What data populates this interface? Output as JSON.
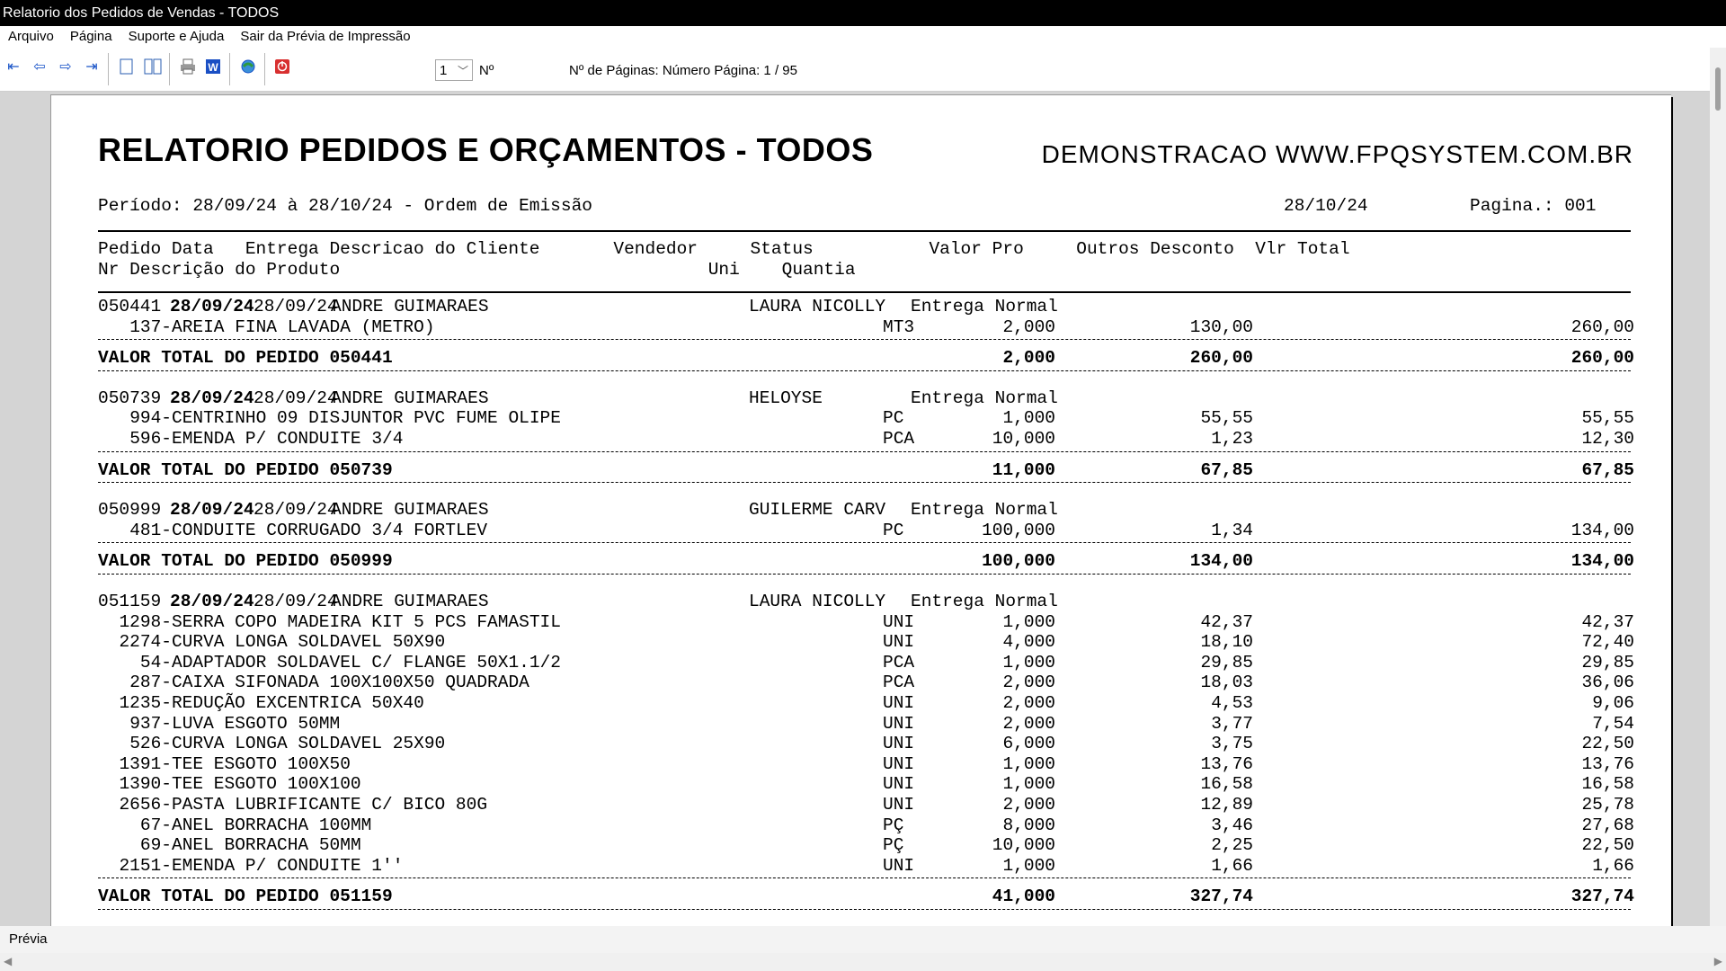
{
  "window": {
    "title": "Relatorio dos Pedidos de Vendas - TODOS"
  },
  "menu": [
    "Arquivo",
    "Página",
    "Suporte e Ajuda",
    "Sair da Prévia de Impressão"
  ],
  "toolbar": {
    "icons": [
      "first-page-icon",
      "prev-page-icon",
      "next-page-icon",
      "last-page-icon",
      "single-page-icon",
      "two-pages-icon",
      "print-icon",
      "word-export-icon",
      "web-icon",
      "stop-icon"
    ],
    "page_select": "1",
    "no_label": "Nº",
    "pages_label": "Nº de Páginas: Número Página: 1 / 95"
  },
  "report": {
    "title": "RELATORIO PEDIDOS E ORÇAMENTOS - TODOS",
    "demo": "DEMONSTRACAO WWW.FPQSYSTEM.COM.BR",
    "periodo": "Período: 28/09/24 à 28/10/24 - Ordem de Emissão",
    "date": "28/10/24",
    "pagina": "Pagina.: 001",
    "header1": "Pedido Data   Entrega Descricao do Cliente       Vendedor     Status           Valor Pro     Outros Desconto  Vlr Total",
    "header2": "Nr Descrição do Produto                                   Uni    Quantia",
    "orders": [
      {
        "num": "050441",
        "data": "28/09/24",
        "entrega": "28/09/24",
        "cliente": "ANDRE GUIMARAES",
        "vendedor": "LAURA NICOLLY",
        "status": "Entrega Normal",
        "items": [
          {
            "desc": "137-AREIA FINA LAVADA (METRO)",
            "uni": "MT3",
            "qtd": "2,000",
            "valor": "130,00",
            "total": "260,00"
          }
        ],
        "total_label": "VALOR TOTAL DO PEDIDO 050441",
        "total_qtd": "2,000",
        "total_valor": "260,00",
        "total_total": "260,00"
      },
      {
        "num": "050739",
        "data": "28/09/24",
        "entrega": "28/09/24",
        "cliente": "ANDRE GUIMARAES",
        "vendedor": "HELOYSE",
        "status": "Entrega Normal",
        "items": [
          {
            "desc": "994-CENTRINHO 09 DISJUNTOR PVC FUME OLIPE",
            "uni": "PC",
            "qtd": "1,000",
            "valor": "55,55",
            "total": "55,55"
          },
          {
            "desc": "596-EMENDA P/ CONDUITE 3/4",
            "uni": "PCA",
            "qtd": "10,000",
            "valor": "1,23",
            "total": "12,30"
          }
        ],
        "total_label": "VALOR TOTAL DO PEDIDO 050739",
        "total_qtd": "11,000",
        "total_valor": "67,85",
        "total_total": "67,85"
      },
      {
        "num": "050999",
        "data": "28/09/24",
        "entrega": "28/09/24",
        "cliente": "ANDRE GUIMARAES",
        "vendedor": "GUILERME CARV",
        "status": "Entrega Normal",
        "items": [
          {
            "desc": "481-CONDUITE CORRUGADO 3/4 FORTLEV",
            "uni": "PC",
            "qtd": "100,000",
            "valor": "1,34",
            "total": "134,00"
          }
        ],
        "total_label": "VALOR TOTAL DO PEDIDO 050999",
        "total_qtd": "100,000",
        "total_valor": "134,00",
        "total_total": "134,00"
      },
      {
        "num": "051159",
        "data": "28/09/24",
        "entrega": "28/09/24",
        "cliente": "ANDRE GUIMARAES",
        "vendedor": "LAURA NICOLLY",
        "status": "Entrega Normal",
        "items": [
          {
            "desc": "1298-SERRA COPO MADEIRA KIT 5 PCS FAMASTIL",
            "uni": "UNI",
            "qtd": "1,000",
            "valor": "42,37",
            "total": "42,37"
          },
          {
            "desc": "2274-CURVA LONGA SOLDAVEL 50X90",
            "uni": "UNI",
            "qtd": "4,000",
            "valor": "18,10",
            "total": "72,40"
          },
          {
            "desc": "54-ADAPTADOR SOLDAVEL C/ FLANGE 50X1.1/2",
            "uni": "PCA",
            "qtd": "1,000",
            "valor": "29,85",
            "total": "29,85"
          },
          {
            "desc": "287-CAIXA SIFONADA 100X100X50 QUADRADA",
            "uni": "PCA",
            "qtd": "2,000",
            "valor": "18,03",
            "total": "36,06"
          },
          {
            "desc": "1235-REDUÇÃO EXCENTRICA 50X40",
            "uni": "UNI",
            "qtd": "2,000",
            "valor": "4,53",
            "total": "9,06"
          },
          {
            "desc": "937-LUVA ESGOTO 50MM",
            "uni": "UNI",
            "qtd": "2,000",
            "valor": "3,77",
            "total": "7,54"
          },
          {
            "desc": "526-CURVA LONGA SOLDAVEL 25X90",
            "uni": "UNI",
            "qtd": "6,000",
            "valor": "3,75",
            "total": "22,50"
          },
          {
            "desc": "1391-TEE ESGOTO 100X50",
            "uni": "UNI",
            "qtd": "1,000",
            "valor": "13,76",
            "total": "13,76"
          },
          {
            "desc": "1390-TEE ESGOTO 100X100",
            "uni": "UNI",
            "qtd": "1,000",
            "valor": "16,58",
            "total": "16,58"
          },
          {
            "desc": "2656-PASTA LUBRIFICANTE C/ BICO 80G",
            "uni": "UNI",
            "qtd": "2,000",
            "valor": "12,89",
            "total": "25,78"
          },
          {
            "desc": "67-ANEL BORRACHA 100MM",
            "uni": "PÇ",
            "qtd": "8,000",
            "valor": "3,46",
            "total": "27,68"
          },
          {
            "desc": "69-ANEL BORRACHA 50MM",
            "uni": "PÇ",
            "qtd": "10,000",
            "valor": "2,25",
            "total": "22,50"
          },
          {
            "desc": "2151-EMENDA P/ CONDUITE 1''",
            "uni": "UNI",
            "qtd": "1,000",
            "valor": "1,66",
            "total": "1,66"
          }
        ],
        "total_label": "VALOR TOTAL DO PEDIDO 051159",
        "total_qtd": "41,000",
        "total_valor": "327,74",
        "total_total": "327,74"
      }
    ]
  },
  "status": {
    "label": "Prévia"
  }
}
